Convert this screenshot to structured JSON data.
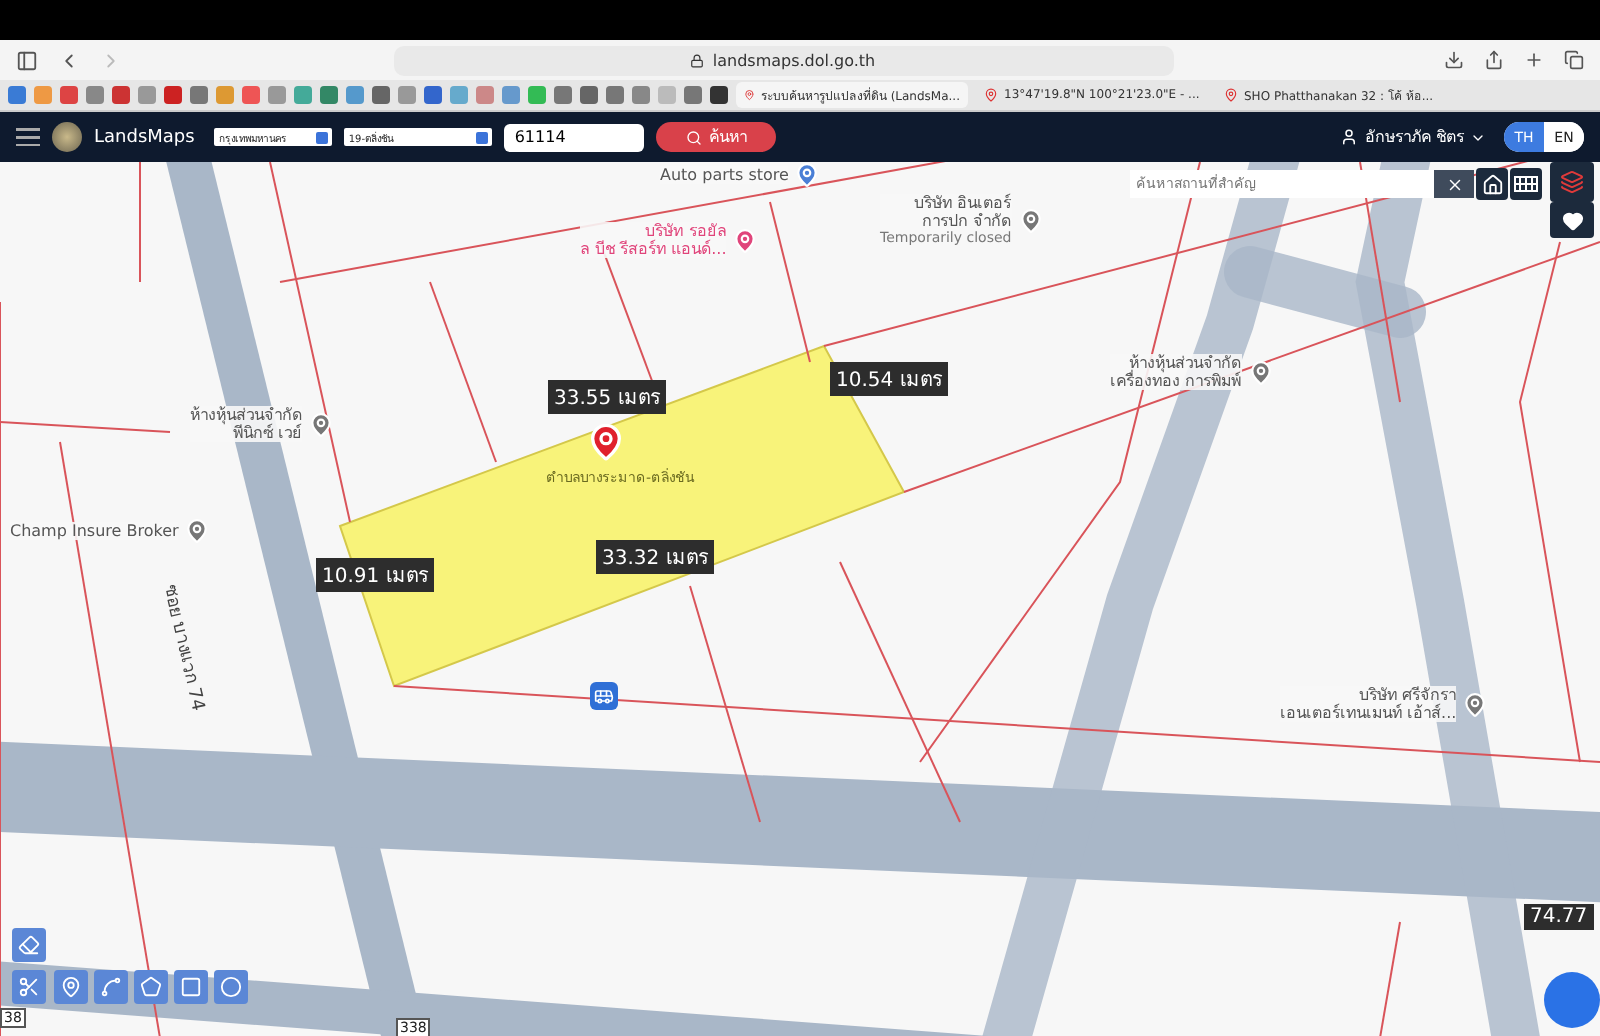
{
  "browser": {
    "url": "landsmaps.dol.go.th",
    "tabs": [
      {
        "title": "ระบบค้นหารูปแปลงที่ดิน (LandsMa...",
        "selected": true
      },
      {
        "title": "13°47'19.8\"N 100°21'23.0\"E - ...",
        "selected": false
      },
      {
        "title": "SHO Phatthanakan 32 : โค้ ห้อ...",
        "selected": false
      }
    ]
  },
  "header": {
    "app_name": "LandsMaps",
    "province": "กรุงเทพมหานคร",
    "district": "19-ตลิ่งชัน",
    "parcel_number": "61114",
    "search_button": "ค้นหา",
    "user": "อักษราภัค ชิตร",
    "languages": [
      {
        "label": "TH",
        "selected": true
      },
      {
        "label": "EN",
        "selected": false
      }
    ]
  },
  "map": {
    "place_search": {
      "placeholder": "ค้นหาสถานที่สำคัญ"
    },
    "measurements": [
      "33.55 เมตร",
      "10.54 เมตร",
      "10.91 เมตร",
      "33.32 เมตร",
      "74.77"
    ],
    "parcel_label": "ตำบลบางระมาด-ตลิ่งชัน",
    "road_label": "ซอย บางแวก 74",
    "route_shields": [
      "38",
      "338"
    ],
    "places": [
      {
        "lines": [
          "Auto parts store"
        ],
        "kind": "shop"
      },
      {
        "lines": [
          "บริษัท อินเตอร์",
          "การปก จำกัด"
        ],
        "status": "Temporarily closed",
        "kind": "business"
      },
      {
        "lines": [
          "บริษัท รอยัล",
          "ล บีช รีสอร์ท แอนด์..."
        ],
        "kind": "hotel"
      },
      {
        "lines": [
          "ห้างหุ้นส่วนจำกัด",
          "เครื่องทอง การพิมพ์"
        ],
        "kind": "business"
      },
      {
        "lines": [
          "ห้างหุ้นส่วนจำกัด",
          "พีนิกซ์ เวย์"
        ],
        "kind": "business"
      },
      {
        "lines": [
          "Champ Insure Broker"
        ],
        "kind": "business"
      },
      {
        "lines": [
          "บริษัท ศรีจักรา",
          "เอนเตอร์เทนเมนท์ เอ้าส์..."
        ],
        "kind": "business"
      }
    ]
  }
}
